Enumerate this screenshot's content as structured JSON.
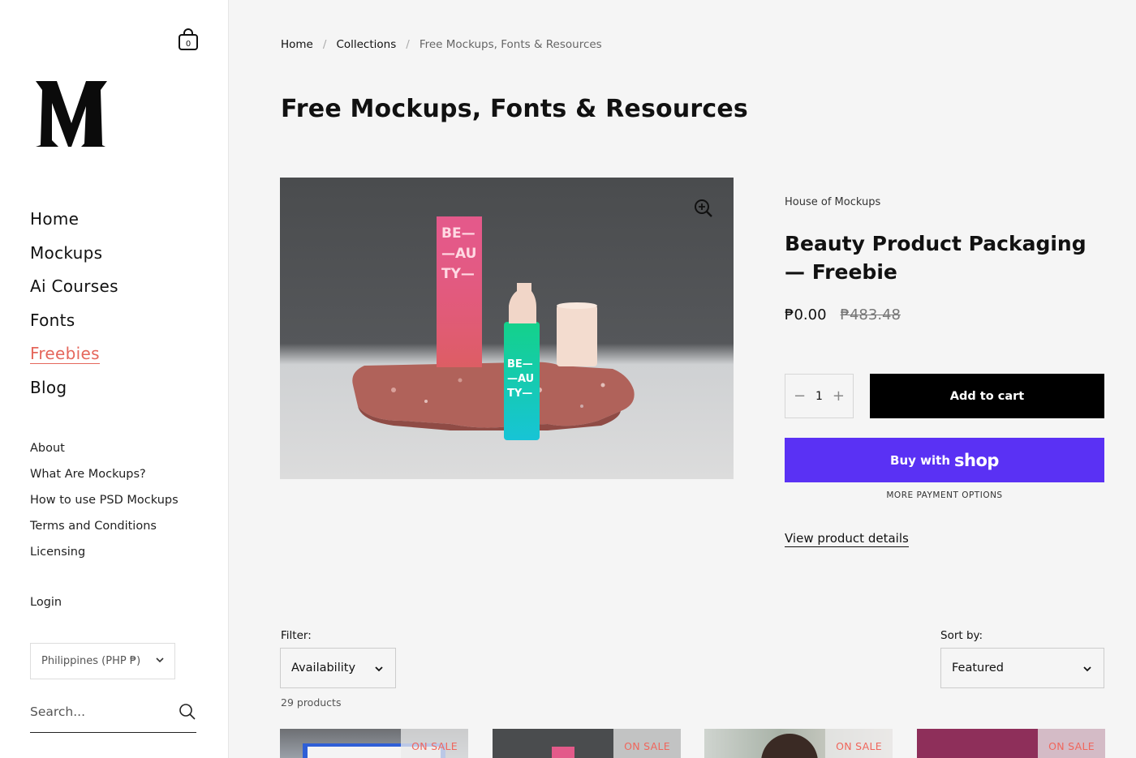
{
  "sidebar": {
    "cart_count": "0",
    "nav_main": [
      "Home",
      "Mockups",
      "Ai Courses",
      "Fonts",
      "Freebies",
      "Blog"
    ],
    "active_item": "Freebies",
    "nav_sub": [
      "About",
      "What Are Mockups?",
      "How to use PSD Mockups",
      "Terms and Conditions",
      "Licensing"
    ],
    "login": "Login",
    "currency": "Philippines (PHP ₱)",
    "search_placeholder": "Search..."
  },
  "breadcrumb": [
    "Home",
    "Collections",
    "Free Mockups, Fonts & Resources"
  ],
  "page_title": "Free Mockups, Fonts & Resources",
  "product": {
    "vendor": "House of Mockups",
    "title": "Beauty Product Packaging — Freebie",
    "price": "₱0.00",
    "compare_price": "₱483.48",
    "quantity": "1",
    "add_to_cart": "Add to cart",
    "buy_with": "Buy with",
    "shop_brand": "shop",
    "more_payment": "MORE PAYMENT OPTIONS",
    "view_details": "View product details",
    "box_text": "BE— —AU TY—",
    "bottle_text": "BE— —AU TY—"
  },
  "filters": {
    "filter_label": "Filter:",
    "filter_value": "Availability",
    "sort_label": "Sort by:",
    "sort_value": "Featured",
    "product_count": "29 products"
  },
  "grid": {
    "badge": "ON SALE"
  },
  "colors": {
    "accent": "#e5675c",
    "shop_purple": "#5a31f4",
    "black_button": "#000000"
  }
}
